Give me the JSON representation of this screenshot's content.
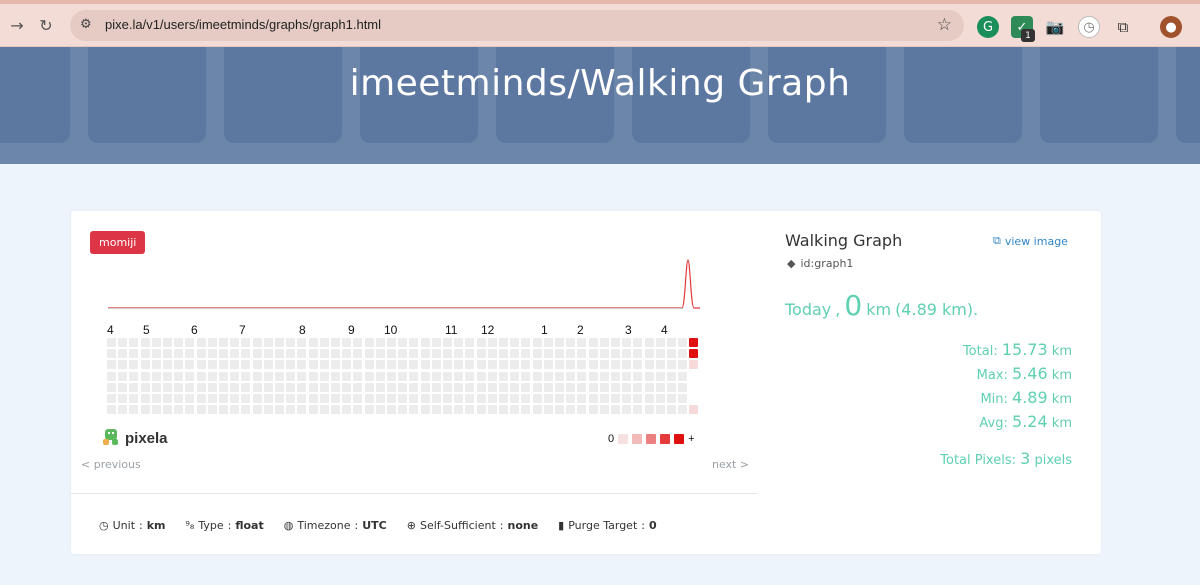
{
  "browser": {
    "url": "pixe.la/v1/users/imeetminds/graphs/graph1.html",
    "extension_badge": "1"
  },
  "header": {
    "title": "imeetminds/Walking Graph"
  },
  "graph": {
    "theme_badge": "momiji",
    "months": [
      "4",
      "5",
      "6",
      "7",
      "8",
      "9",
      "10",
      "11",
      "12",
      "1",
      "2",
      "3",
      "4"
    ],
    "logo_text": "pixela",
    "legend_min": "0",
    "legend_max": "+",
    "legend_colors": [
      "#f6e0e0",
      "#f3baba",
      "#ec7f7f",
      "#e53a3a",
      "#dd0f0f"
    ],
    "empty_color": "#ececec",
    "active_color": "#e01010",
    "pager_prev": "< previous",
    "pager_next": "next >"
  },
  "footer": {
    "unit_label": "Unit",
    "unit_value": "km",
    "type_label": "Type",
    "type_value": "float",
    "timezone_label": "Timezone",
    "timezone_value": "UTC",
    "self_sufficient_label": "Self-Sufficient",
    "self_sufficient_value": "none",
    "purge_label": "Purge Target",
    "purge_value": "0"
  },
  "info": {
    "title": "Walking Graph",
    "view_image": "view image",
    "id_text": "id:graph1",
    "today_label": "Today",
    "today_comma": ",",
    "today_value": "0",
    "today_unit": "km",
    "today_recent": "(4.89 km).",
    "total_label": "Total:",
    "total_value": "15.73",
    "max_label": "Max:",
    "max_value": "5.46",
    "min_label": "Min:",
    "min_value": "4.89",
    "avg_label": "Avg:",
    "avg_value": "5.24",
    "unit": "km",
    "pixels_label": "Total Pixels:",
    "pixels_value": "3",
    "pixels_unit": "pixels"
  }
}
